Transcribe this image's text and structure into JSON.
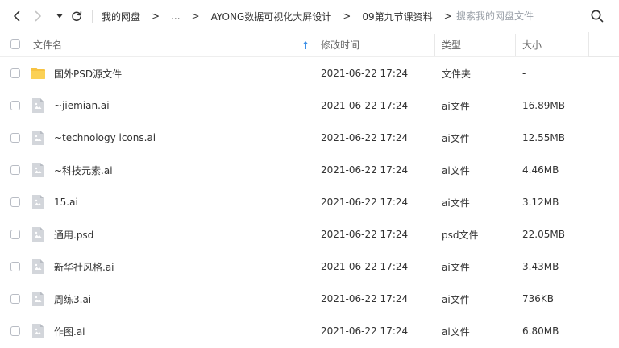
{
  "nav": {
    "breadcrumb": [
      "我的网盘",
      "...",
      "AYONG数据可视化大屏设计",
      "09第九节课资料"
    ],
    "search_placeholder": "搜索我的网盘文件"
  },
  "header": {
    "name": "文件名",
    "time": "修改时间",
    "type": "类型",
    "size": "大小"
  },
  "files": [
    {
      "name": "国外PSD源文件",
      "time": "2021-06-22 17:24",
      "type": "文件夹",
      "size": "-",
      "icon": "folder-icon"
    },
    {
      "name": "~jiemian.ai",
      "time": "2021-06-22 17:24",
      "type": "ai文件",
      "size": "16.89MB",
      "icon": "file-image-icon"
    },
    {
      "name": "~technology icons.ai",
      "time": "2021-06-22 17:24",
      "type": "ai文件",
      "size": "12.55MB",
      "icon": "file-image-icon"
    },
    {
      "name": "~科技元素.ai",
      "time": "2021-06-22 17:24",
      "type": "ai文件",
      "size": "4.46MB",
      "icon": "file-image-icon"
    },
    {
      "name": "15.ai",
      "time": "2021-06-22 17:24",
      "type": "ai文件",
      "size": "3.12MB",
      "icon": "file-image-icon"
    },
    {
      "name": "通用.psd",
      "time": "2021-06-22 17:24",
      "type": "psd文件",
      "size": "22.05MB",
      "icon": "file-image-icon"
    },
    {
      "name": "新华社风格.ai",
      "time": "2021-06-22 17:24",
      "type": "ai文件",
      "size": "3.43MB",
      "icon": "file-image-icon"
    },
    {
      "name": "周练3.ai",
      "time": "2021-06-22 17:24",
      "type": "ai文件",
      "size": "736KB",
      "icon": "file-image-icon"
    },
    {
      "name": "作图.ai",
      "time": "2021-06-22 17:24",
      "type": "ai文件",
      "size": "6.80MB",
      "icon": "file-image-icon"
    }
  ],
  "colors": {
    "folder": "#F7C342",
    "file_icon": "#C9CDD4",
    "sort_arrow": "#3A8EE6"
  }
}
